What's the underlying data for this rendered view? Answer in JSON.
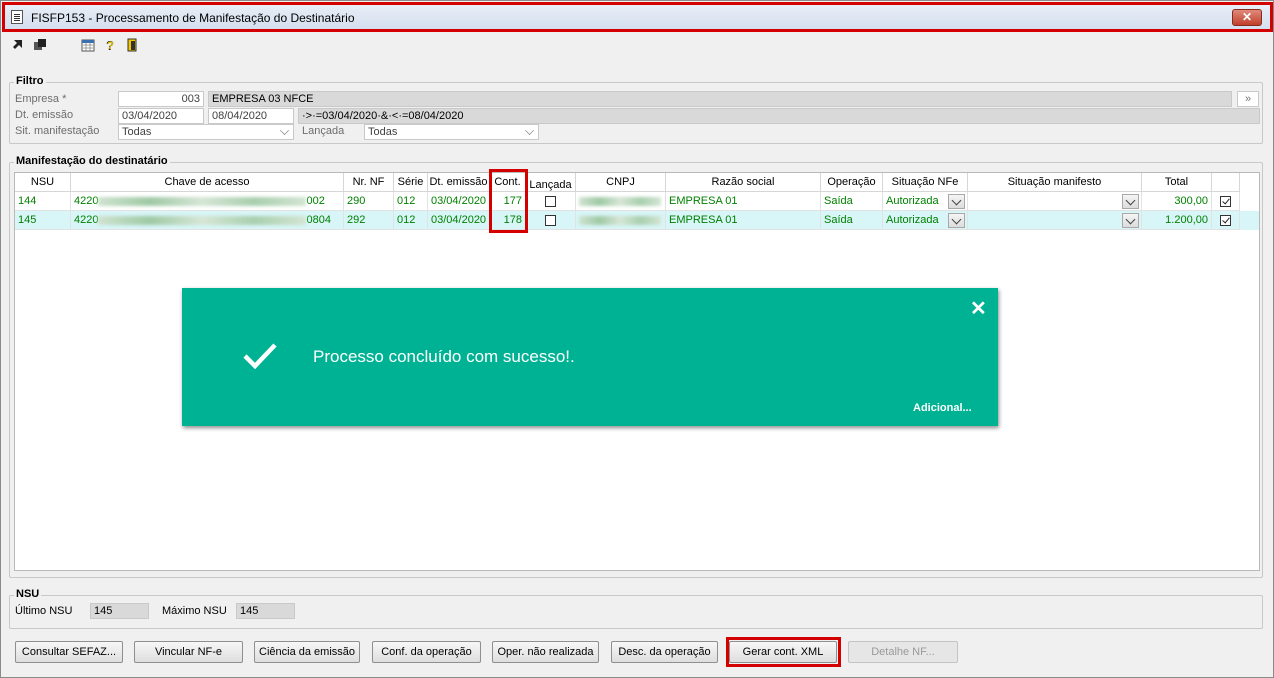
{
  "window": {
    "title": "FISFP153 - Processamento de Manifestação do Destinatário",
    "close_label": "✕"
  },
  "toolbar": {
    "icons": [
      "arrow-select-icon",
      "stack-icon",
      "calendar-icon",
      "help-icon",
      "exit-door-icon"
    ]
  },
  "filter": {
    "legend": "Filtro",
    "empresa_label": "Empresa *",
    "empresa_code": "003",
    "empresa_name": "EMPRESA 03 NFCE",
    "empresa_btn": "»",
    "dt_emissao_label": "Dt. emissão",
    "dt_from": "03/04/2020",
    "dt_to": "08/04/2020",
    "dt_expr": "·>·=03/04/2020·&·<·=08/04/2020",
    "sit_label": "Sit. manifestação",
    "sit_value": "Todas",
    "lancada_label": "Lançada",
    "lancada_value": "Todas"
  },
  "grid": {
    "legend": "Manifestação do destinatário",
    "headers": [
      "NSU",
      "Chave de acesso",
      "Nr. NF",
      "Série",
      "Dt. emissão",
      "Cont.",
      "Lançada",
      "CNPJ",
      "Razão social",
      "Operação",
      "Situação NFe",
      "Situação manifesto",
      "Total"
    ],
    "rows": [
      {
        "nsu": "144",
        "chave_pre": "4220",
        "chave_suf": "002",
        "nr_nf": "290",
        "serie": "012",
        "dt_emissao": "03/04/2020",
        "cont": "177",
        "razao": "EMPRESA 01",
        "operacao": "Saída",
        "sit_nfe": "Autorizada",
        "sit_manif": "",
        "total": "300,00",
        "lancada": false,
        "selected": true
      },
      {
        "nsu": "145",
        "chave_pre": "4220",
        "chave_suf": "0804",
        "nr_nf": "292",
        "serie": "012",
        "dt_emissao": "03/04/2020",
        "cont": "178",
        "razao": "EMPRESA 01",
        "operacao": "Saída",
        "sit_nfe": "Autorizada",
        "sit_manif": "",
        "total": "1.200,00",
        "lancada": false,
        "selected": true
      }
    ]
  },
  "toast": {
    "message": "Processo concluído com sucesso!.",
    "close": "✕",
    "more": "Adicional..."
  },
  "nsu": {
    "legend": "NSU",
    "ultimo_label": "Último NSU",
    "ultimo_value": "145",
    "maximo_label": "Máximo NSU",
    "maximo_value": "145"
  },
  "buttons": {
    "consultar": "Consultar SEFAZ...",
    "vincular": "Vincular NF-e",
    "ciencia": "Ciência da emissão",
    "conf": "Conf. da operação",
    "oper_nao": "Oper. não realizada",
    "desc": "Desc. da operação",
    "gerar": "Gerar cont. XML",
    "detalhe": "Detalhe NF..."
  },
  "colors": {
    "highlight": "#d40000",
    "toast_bg": "#00b294",
    "grid_text": "#008000",
    "selected_row": "#d8f5f7"
  }
}
